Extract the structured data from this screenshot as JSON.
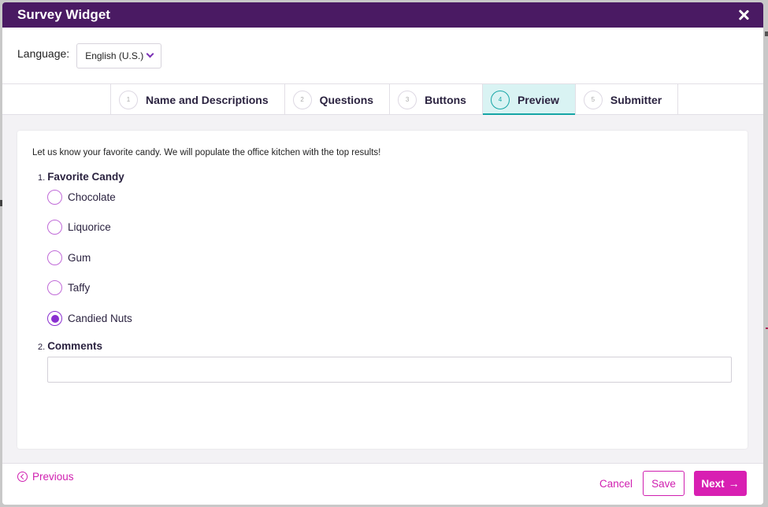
{
  "dialog": {
    "title": "Survey Widget"
  },
  "language": {
    "label": "Language:",
    "selected": "English (U.S.)"
  },
  "tabs": [
    {
      "num": "1",
      "label": "Name and Descriptions"
    },
    {
      "num": "2",
      "label": "Questions"
    },
    {
      "num": "3",
      "label": "Buttons"
    },
    {
      "num": "4",
      "label": "Preview"
    },
    {
      "num": "5",
      "label": "Submitter"
    }
  ],
  "preview": {
    "intro": "Let us know your favorite candy. We will populate the office kitchen with the top results!",
    "q1": {
      "num": "1.",
      "title": "Favorite Candy",
      "options": [
        "Chocolate",
        "Liquorice",
        "Gum",
        "Taffy",
        "Candied Nuts"
      ],
      "selected": "Candied Nuts"
    },
    "q2": {
      "num": "2.",
      "title": "Comments",
      "value": ""
    }
  },
  "footer": {
    "previous": "Previous",
    "cancel": "Cancel",
    "save": "Save",
    "next": "Next"
  },
  "colors": {
    "titlebar": "#4a1a63",
    "active_tab": "#16a5a5",
    "accent": "#d81fb2",
    "radio": "#8a2fd0"
  },
  "icons": {
    "close": "close-icon",
    "language_dropdown": "chevron-down-icon",
    "previous": "chevron-left-circle-icon",
    "next": "arrow-right-icon"
  }
}
